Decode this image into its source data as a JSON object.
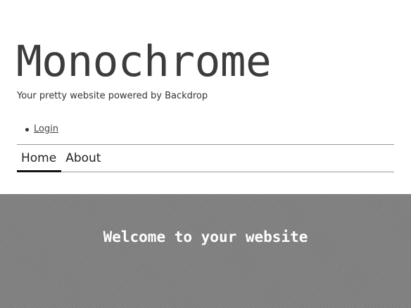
{
  "site": {
    "name": "Monochrome",
    "slogan": "Your pretty website powered by Backdrop"
  },
  "user_menu": {
    "items": [
      {
        "label": "Login"
      }
    ]
  },
  "main_nav": {
    "items": [
      {
        "label": "Home",
        "active": true
      },
      {
        "label": "About",
        "active": false
      }
    ]
  },
  "hero": {
    "title": "Welcome to your website"
  },
  "colors": {
    "hero_background": "#7e7e7e",
    "nav_border": "#9a9a9a",
    "active_underline": "#111111"
  }
}
